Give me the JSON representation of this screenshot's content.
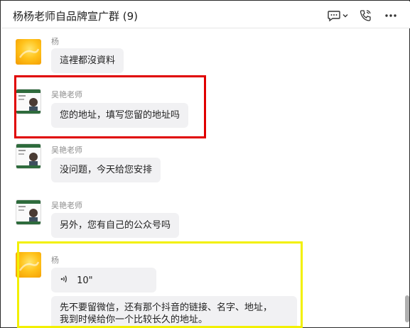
{
  "header": {
    "title": "杨杨老师自品牌宣广群 (9)",
    "icons": [
      "chat-bubble-icon",
      "chevron-down-icon",
      "phone-call-icon",
      "more-dots-icon"
    ]
  },
  "messages": [
    {
      "sender": "杨",
      "avatar": "yellow-flower",
      "text": "這裡都沒資料"
    },
    {
      "sender": "吴艳老师",
      "avatar": "business-card",
      "text": "您的地址，填写您留的地址吗"
    },
    {
      "sender": "吴艳老师",
      "avatar": "business-card",
      "text": "没问题，今天给您安排"
    },
    {
      "sender": "吴艳老师",
      "avatar": "business-card",
      "text": "另外，您有自己的公众号吗"
    },
    {
      "sender": "杨",
      "avatar": "yellow-flower",
      "voice_duration": "10\"",
      "text_line1": "先不要留微信，还有那个抖音的链接、名字、地址，",
      "text_line2": "我到时候给你一个比较长久的地址。"
    }
  ],
  "colors": {
    "highlight_red": "#e00000",
    "highlight_yellow": "#f2f000",
    "bubble_bg": "#f1f1f3"
  }
}
